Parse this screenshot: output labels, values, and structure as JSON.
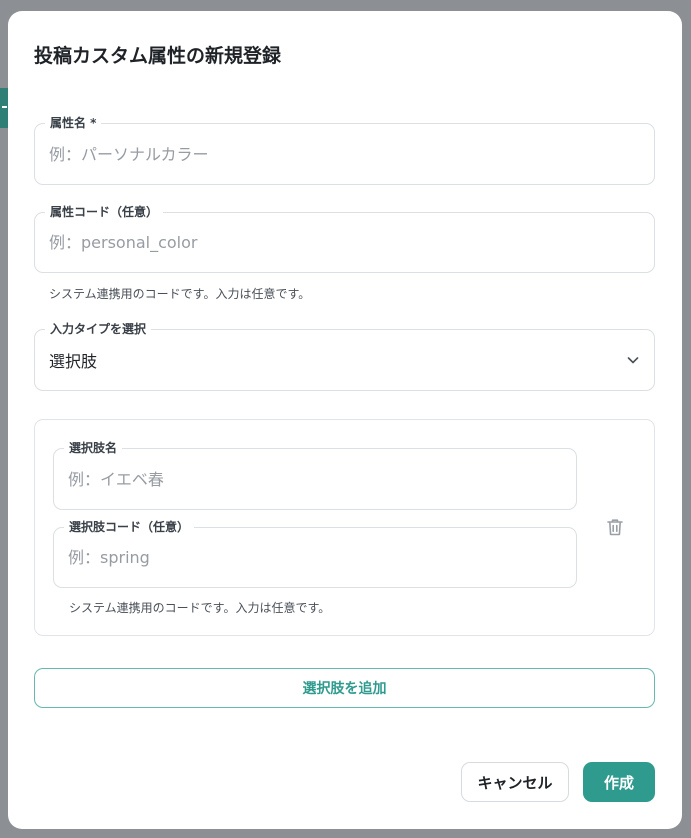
{
  "dialog": {
    "title": "投稿カスタム属性の新規登録"
  },
  "attribute_name": {
    "label": "属性名 *",
    "value": "",
    "placeholder": "例：パーソナルカラー"
  },
  "attribute_code": {
    "label": "属性コード（任意）",
    "value": "",
    "placeholder": "例：personal_color",
    "helper": "システム連携用のコードです。入力は任意です。"
  },
  "input_type": {
    "label": "入力タイプを選択",
    "selected": "選択肢",
    "icon": "chevron-down-icon"
  },
  "option": {
    "name_label": "選択肢名",
    "name_value": "",
    "name_placeholder": "例：イエベ春",
    "code_label": "選択肢コード（任意）",
    "code_value": "",
    "code_placeholder": "例：spring",
    "helper": "システム連携用のコードです。入力は任意です。",
    "delete_icon": "trash-icon"
  },
  "buttons": {
    "add_option": "選択肢を追加",
    "cancel": "キャンセル",
    "create": "作成"
  },
  "colors": {
    "accent": "#2f9b8f",
    "accent_border": "#67b8ae",
    "overlay": "#8c8f93"
  }
}
